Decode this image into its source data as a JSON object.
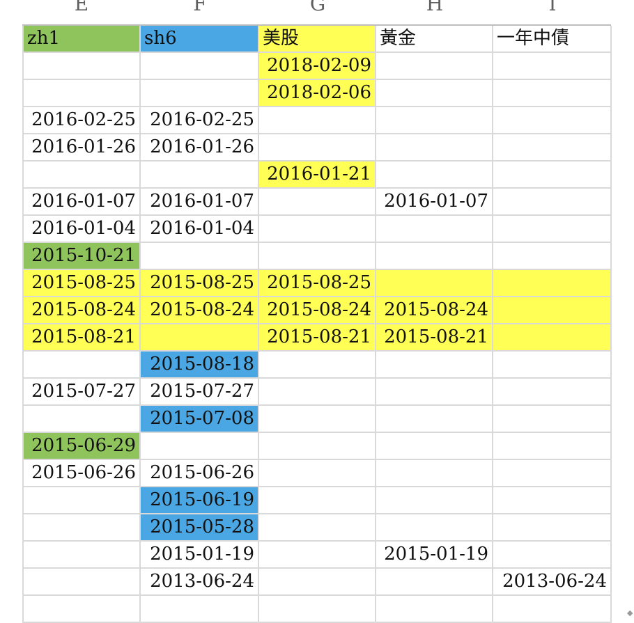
{
  "colors": {
    "green": "#8fc45d",
    "blue": "#4ba7e3",
    "yellow": "#ffff55",
    "grid": "#d9d9d9"
  },
  "column_letters": [
    "E",
    "F",
    "G",
    "H",
    "I"
  ],
  "header_row": [
    "zh1",
    "sh6",
    "美股",
    "黃金",
    "一年中債"
  ],
  "header_fills": [
    "green",
    "blue",
    "yellow",
    "",
    ""
  ],
  "rows": [
    {
      "cells": [
        "",
        "",
        "2018-02-09",
        "",
        ""
      ],
      "fills": [
        "",
        "",
        "yellow",
        "",
        ""
      ]
    },
    {
      "cells": [
        "",
        "",
        "2018-02-06",
        "",
        ""
      ],
      "fills": [
        "",
        "",
        "yellow",
        "",
        ""
      ]
    },
    {
      "cells": [
        "2016-02-25",
        "2016-02-25",
        "",
        "",
        ""
      ],
      "fills": [
        "",
        "",
        "",
        "",
        ""
      ]
    },
    {
      "cells": [
        "2016-01-26",
        "2016-01-26",
        "",
        "",
        ""
      ],
      "fills": [
        "",
        "",
        "",
        "",
        ""
      ]
    },
    {
      "cells": [
        "",
        "",
        "2016-01-21",
        "",
        ""
      ],
      "fills": [
        "",
        "",
        "yellow",
        "",
        ""
      ]
    },
    {
      "cells": [
        "2016-01-07",
        "2016-01-07",
        "",
        "2016-01-07",
        ""
      ],
      "fills": [
        "",
        "",
        "",
        "",
        ""
      ]
    },
    {
      "cells": [
        "2016-01-04",
        "2016-01-04",
        "",
        "",
        ""
      ],
      "fills": [
        "",
        "",
        "",
        "",
        ""
      ]
    },
    {
      "cells": [
        "2015-10-21",
        "",
        "",
        "",
        ""
      ],
      "fills": [
        "green",
        "",
        "",
        "",
        ""
      ]
    },
    {
      "cells": [
        "2015-08-25",
        "2015-08-25",
        "2015-08-25",
        "",
        ""
      ],
      "fills": [
        "yellow",
        "yellow",
        "yellow",
        "yellow",
        "yellow"
      ]
    },
    {
      "cells": [
        "2015-08-24",
        "2015-08-24",
        "2015-08-24",
        "2015-08-24",
        ""
      ],
      "fills": [
        "yellow",
        "yellow",
        "yellow",
        "yellow",
        "yellow"
      ]
    },
    {
      "cells": [
        "2015-08-21",
        "",
        "2015-08-21",
        "2015-08-21",
        ""
      ],
      "fills": [
        "yellow",
        "yellow",
        "yellow",
        "yellow",
        "yellow"
      ]
    },
    {
      "cells": [
        "",
        "2015-08-18",
        "",
        "",
        ""
      ],
      "fills": [
        "",
        "blue",
        "",
        "",
        ""
      ]
    },
    {
      "cells": [
        "2015-07-27",
        "2015-07-27",
        "",
        "",
        ""
      ],
      "fills": [
        "",
        "",
        "",
        "",
        ""
      ]
    },
    {
      "cells": [
        "",
        "2015-07-08",
        "",
        "",
        ""
      ],
      "fills": [
        "",
        "blue",
        "",
        "",
        ""
      ]
    },
    {
      "cells": [
        "2015-06-29",
        "",
        "",
        "",
        ""
      ],
      "fills": [
        "green",
        "",
        "",
        "",
        ""
      ]
    },
    {
      "cells": [
        "2015-06-26",
        "2015-06-26",
        "",
        "",
        ""
      ],
      "fills": [
        "",
        "",
        "",
        "",
        ""
      ]
    },
    {
      "cells": [
        "",
        "2015-06-19",
        "",
        "",
        ""
      ],
      "fills": [
        "",
        "blue",
        "",
        "",
        ""
      ]
    },
    {
      "cells": [
        "",
        "2015-05-28",
        "",
        "",
        ""
      ],
      "fills": [
        "",
        "blue",
        "",
        "",
        ""
      ]
    },
    {
      "cells": [
        "",
        "2015-01-19",
        "",
        "2015-01-19",
        ""
      ],
      "fills": [
        "",
        "",
        "",
        "",
        ""
      ]
    },
    {
      "cells": [
        "",
        "2013-06-24",
        "",
        "",
        "2013-06-24"
      ],
      "fills": [
        "",
        "",
        "",
        "",
        ""
      ]
    },
    {
      "cells": [
        "",
        "",
        "",
        "",
        ""
      ],
      "fills": [
        "",
        "",
        "",
        "",
        ""
      ]
    }
  ],
  "corner_icon": "resize-grip-icon"
}
